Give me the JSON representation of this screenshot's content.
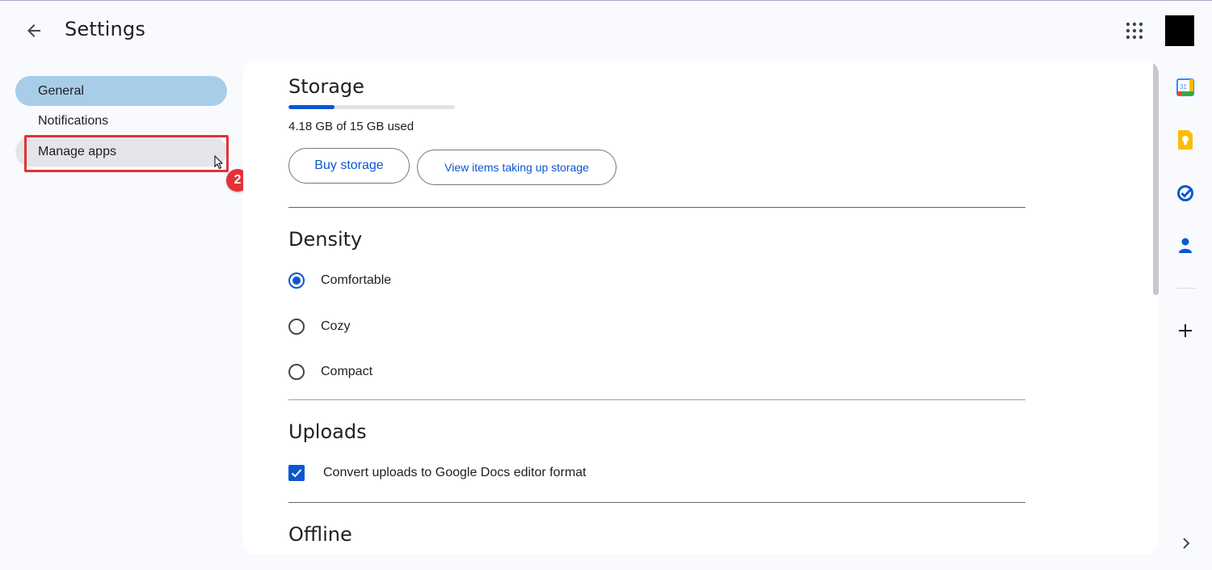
{
  "header": {
    "title": "Settings",
    "back_icon": "arrow-left-icon",
    "apps_icon": "apps-grid-icon"
  },
  "nav": {
    "items": [
      {
        "label": "General",
        "selected": true
      },
      {
        "label": "Notifications",
        "selected": false
      },
      {
        "label": "Manage apps",
        "selected": false,
        "hovered": true
      }
    ],
    "annotation_step": "2"
  },
  "storage": {
    "title": "Storage",
    "used_text": "4.18 GB of 15 GB used",
    "used_fraction": 0.279,
    "buy_label": "Buy storage",
    "view_label": "View items taking up storage"
  },
  "density": {
    "title": "Density",
    "options": [
      {
        "label": "Comfortable",
        "checked": true
      },
      {
        "label": "Cozy",
        "checked": false
      },
      {
        "label": "Compact",
        "checked": false
      }
    ]
  },
  "uploads": {
    "title": "Uploads",
    "convert_label": "Convert uploads to Google Docs editor format",
    "convert_checked": true
  },
  "offline": {
    "title": "Offline"
  },
  "side_panel": {
    "calendar_day": "31",
    "icons": [
      "calendar-icon",
      "keep-icon",
      "tasks-icon",
      "contacts-icon",
      "add-icon",
      "expand-icon"
    ]
  },
  "colors": {
    "accent": "#0b57d0",
    "nav_selected": "#a8cde8",
    "annotation": "#e53038"
  }
}
